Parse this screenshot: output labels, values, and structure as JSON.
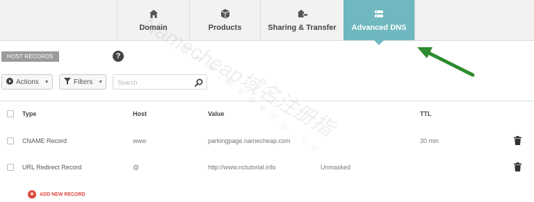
{
  "tabs": [
    {
      "label": "Domain",
      "icon": "home-icon",
      "active": false
    },
    {
      "label": "Products",
      "icon": "box-icon",
      "active": false
    },
    {
      "label": "Sharing & Transfer",
      "icon": "share-icon",
      "active": false
    },
    {
      "label": "Advanced DNS",
      "icon": "dns-icon",
      "active": true
    }
  ],
  "section": {
    "title": "HOST RECORDS",
    "help": "?"
  },
  "toolbar": {
    "actions_label": "Actions",
    "filters_label": "Filters",
    "search_placeholder": "Search"
  },
  "table": {
    "headers": {
      "type": "Type",
      "host": "Host",
      "value": "Value",
      "ttl": "TTL"
    },
    "rows": [
      {
        "type": "CNAME Record",
        "host": "www",
        "value": "parkingpage.namecheap.com",
        "extra": "",
        "ttl": "30 min"
      },
      {
        "type": "URL Redirect Record",
        "host": "@",
        "value": "http://www.nctutorial.info",
        "extra": "Unmasked",
        "ttl": ""
      }
    ]
  },
  "add_record_label": "ADD NEW RECORD",
  "watermark": {
    "main": "Namecheap域名注册指",
    "sub": "www.kedeng.co"
  },
  "colors": {
    "accent": "#6fb8bf",
    "add": "#d9463b",
    "arrow": "#2e8b2e"
  }
}
